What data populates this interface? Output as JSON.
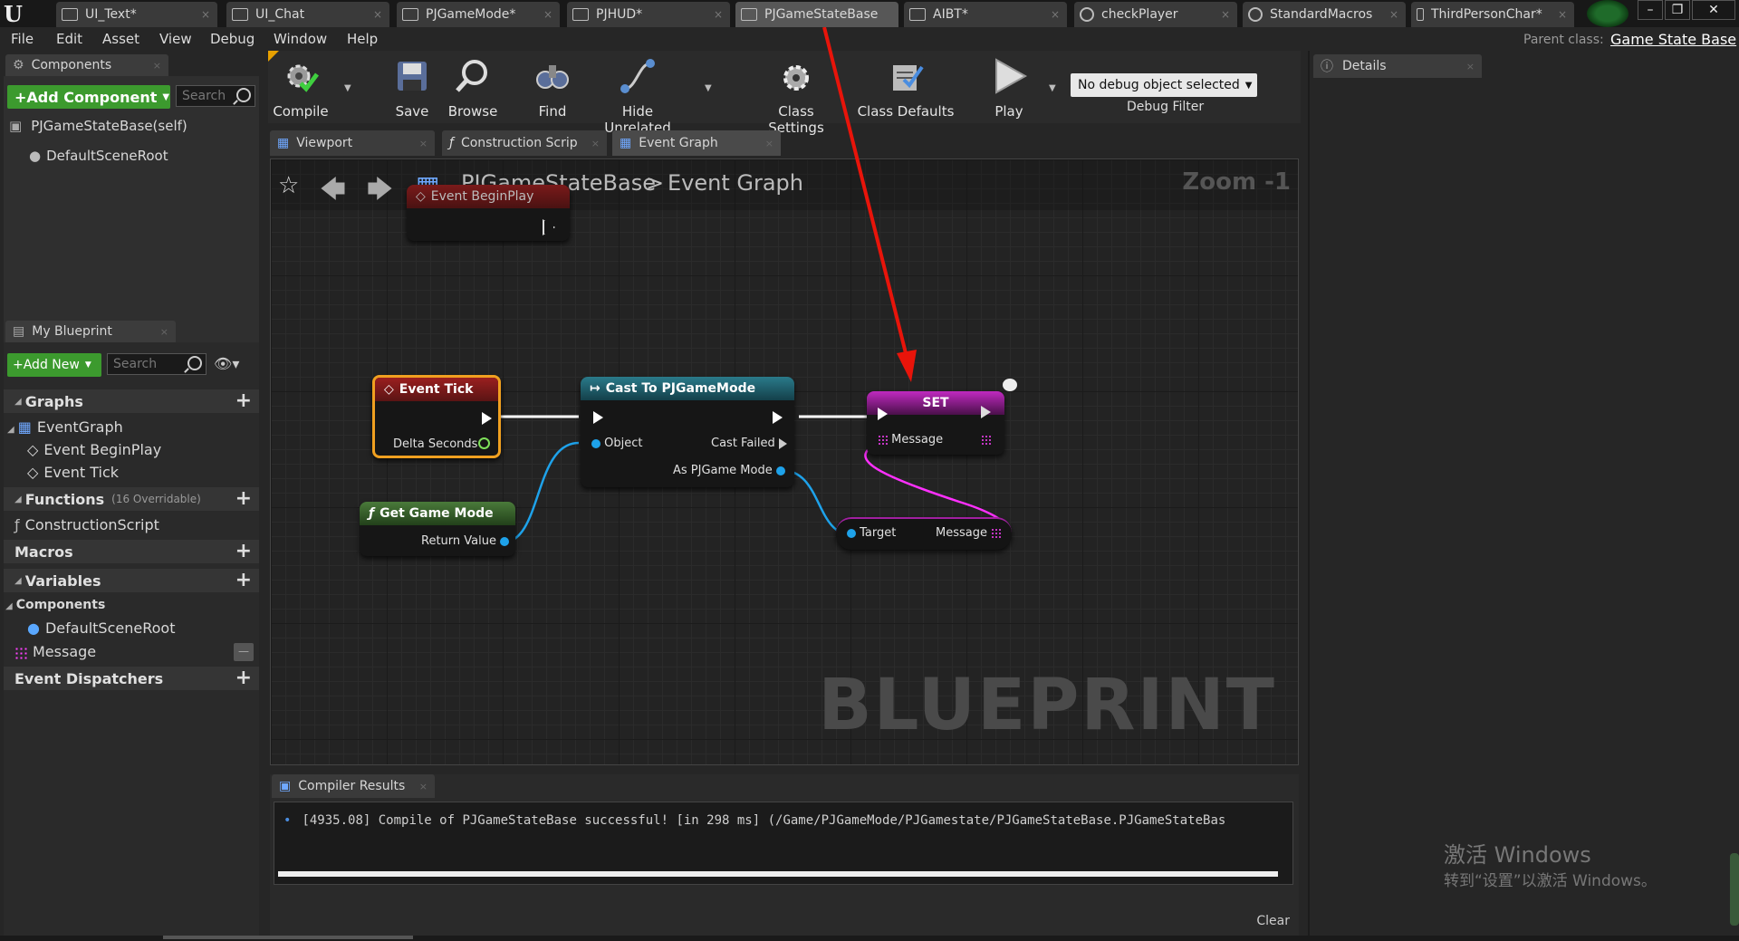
{
  "colors": {
    "accent_green": "#3c9a2e",
    "event_red": "#8b1d1d",
    "cast_teal": "#1f5a6a",
    "set_magenta": "#b01fb0",
    "func_green": "#3b6b2f",
    "wire_blue": "#1ea2ea",
    "wire_magenta": "#ff30ff",
    "arrow_red": "#e8140a"
  },
  "document_tabs": [
    "UI_Text*",
    "UI_Chat",
    "PJGameMode*",
    "PJHUD*",
    "PJGameStateBase",
    "AIBT*",
    "checkPlayer",
    "StandardMacros",
    "ThirdPersonChar*"
  ],
  "menu": [
    "File",
    "Edit",
    "Asset",
    "View",
    "Debug",
    "Window",
    "Help"
  ],
  "parent_class_label": "Parent class:",
  "parent_class_value": "Game State Base",
  "components": {
    "tab": "Components",
    "add_button": "+Add Component",
    "search_placeholder": "Search",
    "self_item": "PJGameStateBase(self)",
    "root_item": "DefaultSceneRoot"
  },
  "toolbar": {
    "compile": "Compile",
    "save": "Save",
    "browse": "Browse",
    "find": "Find",
    "hide_unrelated": "Hide Unrelated",
    "class_settings": "Class Settings",
    "class_defaults": "Class Defaults",
    "play": "Play",
    "debug_select": "No debug object selected",
    "debug_filter": "Debug Filter"
  },
  "editor_tabs": [
    "Viewport",
    "Construction Scrip",
    "Event Graph"
  ],
  "breadcrumb": {
    "root": "PJGameStateBase",
    "separator": ">",
    "current": "Event Graph"
  },
  "zoom": "Zoom -1",
  "watermark": "BLUEPRINT",
  "my_blueprint": {
    "tab": "My Blueprint",
    "add_new": "+Add New",
    "search_placeholder": "Search",
    "graphs": "Graphs",
    "event_graph": "EventGraph",
    "event_beginplay": "Event BeginPlay",
    "event_tick": "Event Tick",
    "functions": "Functions",
    "overridable": "(16 Overridable)",
    "construction_script": "ConstructionScript",
    "macros": "Macros",
    "variables": "Variables",
    "components_cat": "Components",
    "default_scene_root": "DefaultSceneRoot",
    "message_var": "Message",
    "event_dispatchers": "Event Dispatchers"
  },
  "nodes": {
    "begin_play": "Event BeginPlay",
    "event_tick": "Event Tick",
    "delta_seconds": "Delta Seconds",
    "cast_title": "Cast To PJGameMode",
    "cast_object": "Object",
    "cast_failed": "Cast Failed",
    "cast_as": "As PJGame Mode",
    "get_game_mode": "Get Game Mode",
    "return_value": "Return Value",
    "set_title": "SET",
    "set_message": "Message",
    "getter_target": "Target",
    "getter_message": "Message"
  },
  "details": {
    "tab": "Details"
  },
  "compiler": {
    "tab": "Compiler Results",
    "log": "[4935.08] Compile of PJGameStateBase successful! [in 298 ms] (/Game/PJGameMode/PJGamestate/PJGameStateBase.PJGameStateBas",
    "clear": "Clear"
  },
  "windows_watermark": {
    "line1": "激活 Windows",
    "line2": "转到“设置”以激活 Windows。"
  }
}
